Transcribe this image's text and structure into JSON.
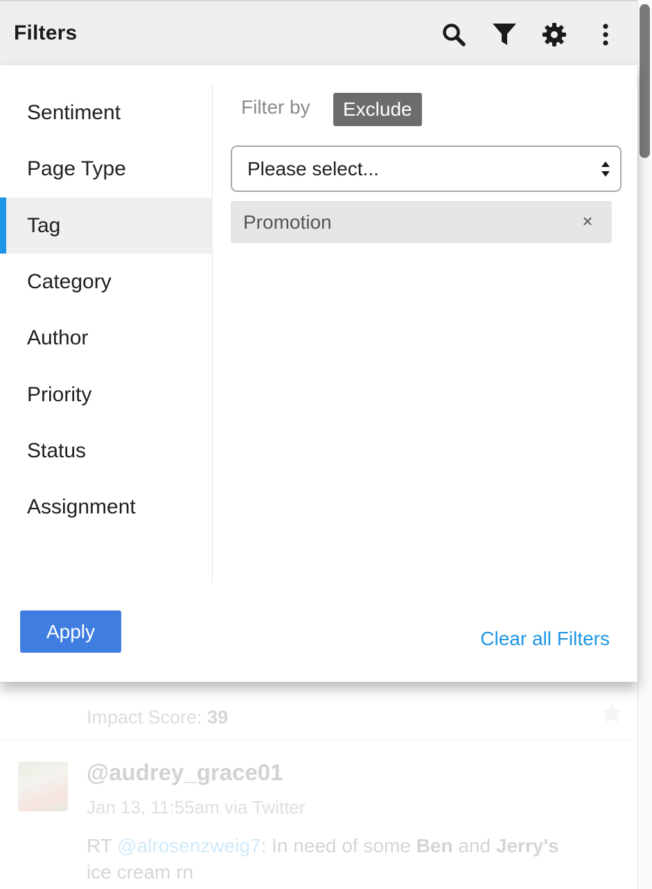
{
  "header": {
    "title": "Filters",
    "icons": [
      "search-icon",
      "funnel-icon",
      "gear-icon",
      "more-vertical-icon"
    ]
  },
  "sidebar": {
    "items": [
      {
        "label": "Sentiment",
        "active": false
      },
      {
        "label": "Page Type",
        "active": false
      },
      {
        "label": "Tag",
        "active": true
      },
      {
        "label": "Category",
        "active": false
      },
      {
        "label": "Author",
        "active": false
      },
      {
        "label": "Priority",
        "active": false
      },
      {
        "label": "Status",
        "active": false
      },
      {
        "label": "Assignment",
        "active": false
      }
    ]
  },
  "filter": {
    "filter_by_label": "Filter by",
    "mode": "Exclude",
    "select_placeholder": "Please select...",
    "selected_tags": [
      "Promotion"
    ],
    "chip_close": "×"
  },
  "footer": {
    "apply_label": "Apply",
    "clear_label": "Clear all Filters"
  },
  "feed": {
    "impact_label": "Impact Score:",
    "impact_value": "39",
    "post": {
      "handle": "@audrey_grace01",
      "meta": "Jan 13, 11:55am via Twitter",
      "text_prefix": "RT ",
      "mention": "@alrosenzweig7",
      "text_1": ": In need of some ",
      "bold_1": "Ben",
      "text_2": " and ",
      "bold_2": "Jerry's",
      "text_3": " ice cream rn"
    }
  },
  "colors": {
    "accent": "#1c96e4",
    "apply_button": "#3f7ee0",
    "header_bg": "#efefef",
    "exclude_badge": "#6c6c6c"
  }
}
